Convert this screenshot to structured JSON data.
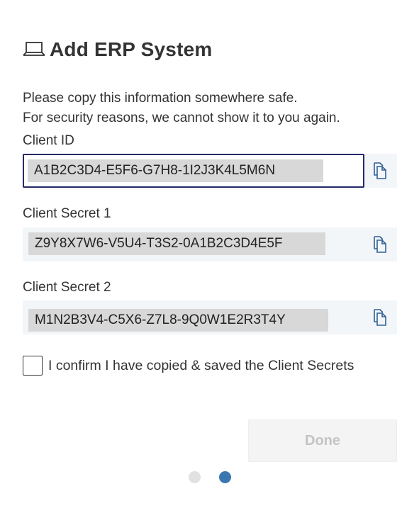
{
  "dialog": {
    "title": "Add ERP System",
    "title_icon": "laptop-icon",
    "notice_line1": "Please copy this information somewhere safe.",
    "notice_line2": "For security reasons, we cannot show it to you again.",
    "fields": [
      {
        "label": "Client ID",
        "value": "A1B2C3D4-E5F6-G7H8-1I2J3K4L5M6N",
        "copy_icon": "copy-icon",
        "focused": true
      },
      {
        "label": "Client Secret 1",
        "value": "Z9Y8X7W6-V5U4-T3S2-0A1B2C3D4E5F",
        "copy_icon": "copy-icon",
        "focused": false
      },
      {
        "label": "Client Secret 2",
        "value": "M1N2B3V4-C5X6-Z7L8-9Q0W1E2R3T4Y",
        "copy_icon": "copy-icon",
        "focused": false
      }
    ],
    "confirm_label": "I confirm I have copied & saved the Client Secrets",
    "confirm_checked": false,
    "done_label": "Done",
    "done_disabled": true,
    "pager": {
      "total": 2,
      "current": 2
    }
  },
  "colors": {
    "accent": "#3a77b0",
    "focus_border": "#262a66",
    "field_bg": "#f3f6f9",
    "value_highlight": "#d8d8d8",
    "disabled_text": "#c4c4c4"
  }
}
